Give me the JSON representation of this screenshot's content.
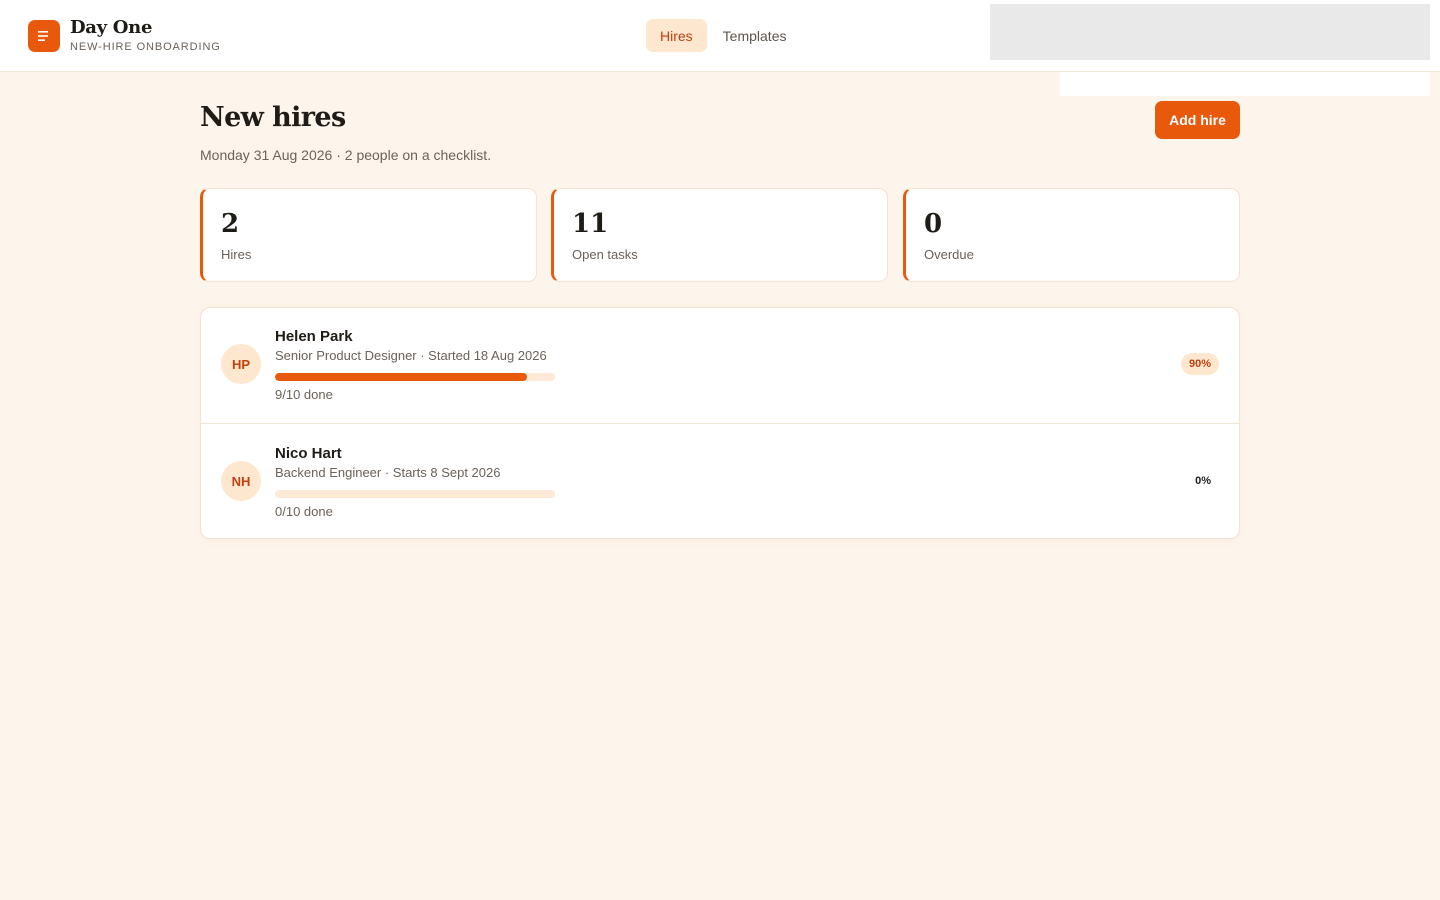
{
  "app": {
    "name": "Day One",
    "subtitle": "NEW-HIRE ONBOARDING",
    "logo_icon": "menu-lines-icon"
  },
  "nav": {
    "tabs": [
      {
        "label": "Hires",
        "active": true
      },
      {
        "label": "Templates",
        "active": false
      }
    ]
  },
  "page": {
    "title": "New hires",
    "subtitle": "Monday 31 Aug 2026 · 2 people on a checklist.",
    "add_button": "Add hire"
  },
  "stats": [
    {
      "value": "2",
      "label": "Hires"
    },
    {
      "value": "11",
      "label": "Open tasks"
    },
    {
      "value": "0",
      "label": "Overdue"
    }
  ],
  "hires": [
    {
      "initials": "HP",
      "name": "Helen Park",
      "detail": "Senior Product Designer · Started 18 Aug 2026",
      "progress": 0.9,
      "done_text": "9/10 done",
      "percent": "90%"
    },
    {
      "initials": "NH",
      "name": "Nico Hart",
      "detail": "Backend Engineer · Starts 8 Sept 2026",
      "progress": 0,
      "done_text": "0/10 done",
      "percent": "0%"
    }
  ],
  "colors": {
    "accent": "#e8590c",
    "accent_soft": "#fde7cf",
    "background": "#fdf5ec"
  }
}
